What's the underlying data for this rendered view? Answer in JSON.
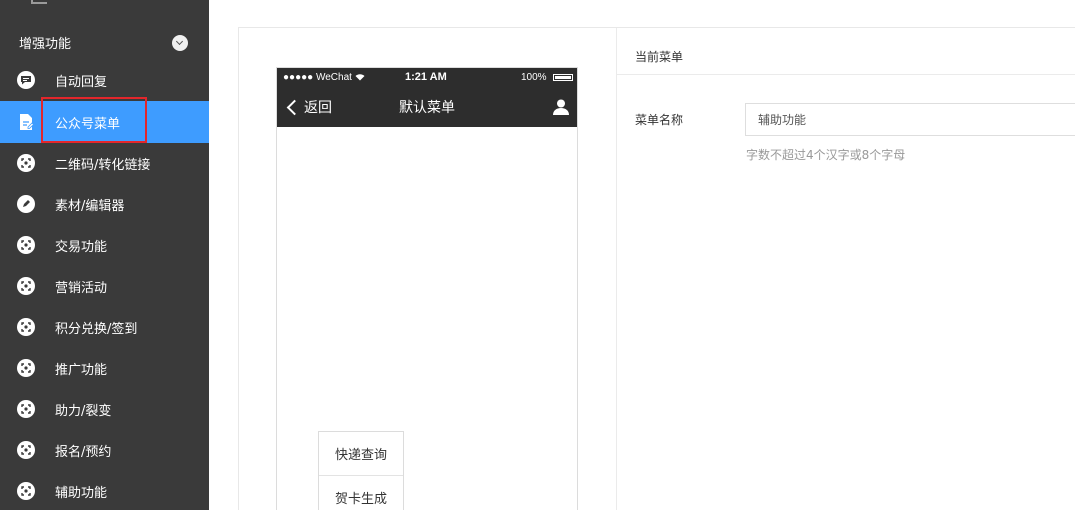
{
  "sidebar": {
    "section_title": "增强功能",
    "items": [
      {
        "label": "自动回复",
        "icon": "chat-bubble-icon"
      },
      {
        "label": "公众号菜单",
        "icon": "document-edit-icon"
      },
      {
        "label": "二维码/转化链接",
        "icon": "module-icon"
      },
      {
        "label": "素材/编辑器",
        "icon": "pencil-icon"
      },
      {
        "label": "交易功能",
        "icon": "module-icon"
      },
      {
        "label": "营销活动",
        "icon": "module-icon"
      },
      {
        "label": "积分兑换/签到",
        "icon": "module-icon"
      },
      {
        "label": "推广功能",
        "icon": "module-icon"
      },
      {
        "label": "助力/裂变",
        "icon": "module-icon"
      },
      {
        "label": "报名/预约",
        "icon": "module-icon"
      },
      {
        "label": "辅助功能",
        "icon": "module-icon"
      }
    ]
  },
  "phone": {
    "carrier": "●●●●● WeChat",
    "time": "1:21 AM",
    "battery": "100%",
    "back_label": "返回",
    "title": "默认菜单",
    "submenu": [
      "快递查询",
      "贺卡生成"
    ]
  },
  "editor": {
    "section_title": "当前菜单",
    "name_label": "菜单名称",
    "name_value": "辅助功能",
    "name_hint": "字数不超过4个汉字或8个字母"
  },
  "colors": {
    "sidebar_bg": "#3a3a3a",
    "active_bg": "#3e9cff",
    "highlight": "#e3262b"
  }
}
